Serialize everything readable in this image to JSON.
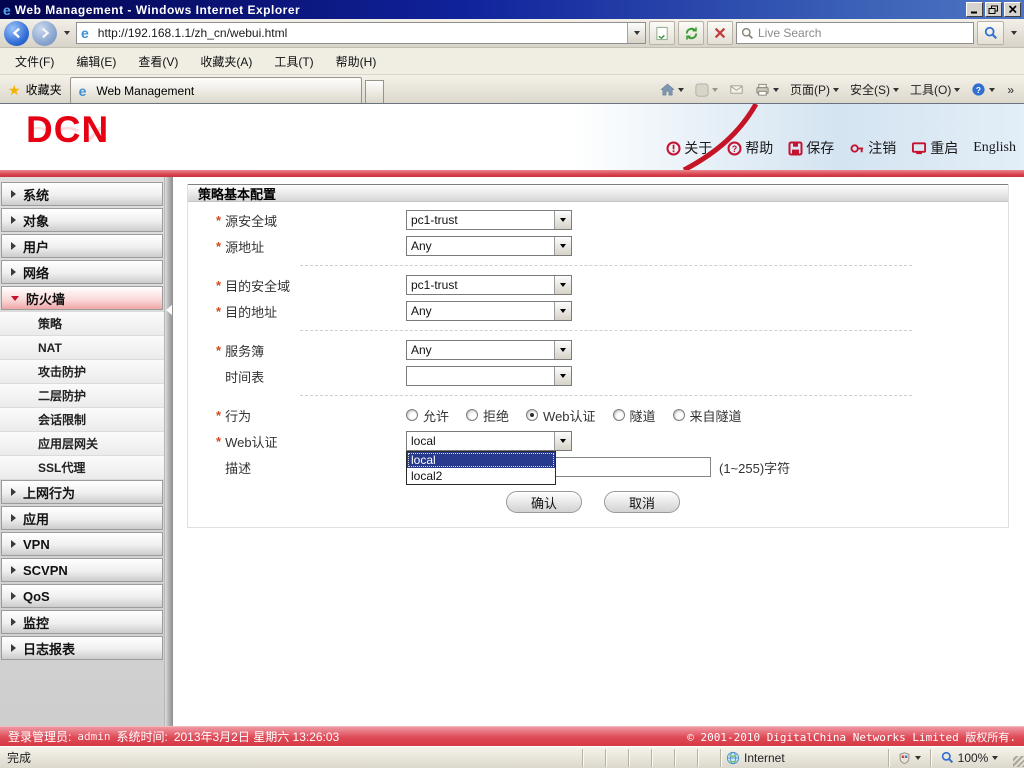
{
  "window": {
    "title": "Web Management - Windows Internet Explorer"
  },
  "browser": {
    "url": "http://192.168.1.1/zh_cn/webui.html",
    "search_placeholder": "Live Search",
    "menu": [
      "文件(F)",
      "编辑(E)",
      "查看(V)",
      "收藏夹(A)",
      "工具(T)",
      "帮助(H)"
    ],
    "favorites_label": "收藏夹",
    "tab_title": "Web Management",
    "command_bar": {
      "page": "页面(P)",
      "security": "安全(S)",
      "tools": "工具(O)",
      "more": "»"
    },
    "status": {
      "done": "完成",
      "zone": "Internet",
      "zoom_level": "100%"
    }
  },
  "app": {
    "brand": "DCN",
    "header_links": [
      {
        "key": "about",
        "label": "关于"
      },
      {
        "key": "help",
        "label": "帮助"
      },
      {
        "key": "save",
        "label": "保存"
      },
      {
        "key": "logout",
        "label": "注销"
      },
      {
        "key": "reboot",
        "label": "重启"
      },
      {
        "key": "english",
        "label": "English"
      }
    ],
    "sidebar": [
      {
        "key": "system",
        "label": "系统",
        "type": "group"
      },
      {
        "key": "object",
        "label": "对象",
        "type": "group"
      },
      {
        "key": "user",
        "label": "用户",
        "type": "group"
      },
      {
        "key": "network",
        "label": "网络",
        "type": "group"
      },
      {
        "key": "firewall",
        "label": "防火墙",
        "type": "group-expanded"
      },
      {
        "key": "policy",
        "label": "策略",
        "type": "sub-active"
      },
      {
        "key": "nat",
        "label": "NAT",
        "type": "sub"
      },
      {
        "key": "attack-defense",
        "label": "攻击防护",
        "type": "sub"
      },
      {
        "key": "l2-defense",
        "label": "二层防护",
        "type": "sub"
      },
      {
        "key": "session-limit",
        "label": "会话限制",
        "type": "sub"
      },
      {
        "key": "alg",
        "label": "应用层网关",
        "type": "sub"
      },
      {
        "key": "ssl-proxy",
        "label": "SSL代理",
        "type": "sub"
      },
      {
        "key": "web-behavior",
        "label": "上网行为",
        "type": "group"
      },
      {
        "key": "application",
        "label": "应用",
        "type": "group"
      },
      {
        "key": "vpn",
        "label": "VPN",
        "type": "group"
      },
      {
        "key": "scvpn",
        "label": "SCVPN",
        "type": "group"
      },
      {
        "key": "qos",
        "label": "QoS",
        "type": "group"
      },
      {
        "key": "monitor",
        "label": "监控",
        "type": "group"
      },
      {
        "key": "log-report",
        "label": "日志报表",
        "type": "group"
      }
    ],
    "form": {
      "title": "策略基本配置",
      "required_marker": "*",
      "src_zone": {
        "label": "源安全域",
        "value": "pc1-trust",
        "required": true
      },
      "src_addr": {
        "label": "源地址",
        "value": "Any",
        "required": true
      },
      "dst_zone": {
        "label": "目的安全域",
        "value": "pc1-trust",
        "required": true
      },
      "dst_addr": {
        "label": "目的地址",
        "value": "Any",
        "required": true
      },
      "service": {
        "label": "服务簿",
        "value": "Any",
        "required": true
      },
      "schedule": {
        "label": "时间表",
        "value": "",
        "required": false
      },
      "action": {
        "label": "行为",
        "required": true,
        "options": [
          "允许",
          "拒绝",
          "Web认证",
          "隧道",
          "来自隧道"
        ],
        "selected": "Web认证"
      },
      "webauth": {
        "label": "Web认证",
        "required": true,
        "value": "local",
        "options": [
          "local",
          "local2"
        ],
        "highlighted": "local"
      },
      "description": {
        "label": "描述",
        "value": "",
        "hint": "(1~255)字符"
      },
      "buttons": {
        "confirm": "确认",
        "cancel": "取消"
      }
    },
    "footer": {
      "admin_label": "登录管理员:",
      "admin_value": "admin",
      "time_label": "系统时间:",
      "time_value": "2013年3月2日 星期六 13:26:03",
      "copyright": "© 2001-2010 DigitalChina Networks Limited 版权所有."
    }
  },
  "colors": {
    "brand_red": "#e60012",
    "accent_red": "#c41230",
    "header_bar_red": "#d63c48",
    "selection_navy": "#273a8e",
    "titlebar_blue": "#10229b"
  }
}
